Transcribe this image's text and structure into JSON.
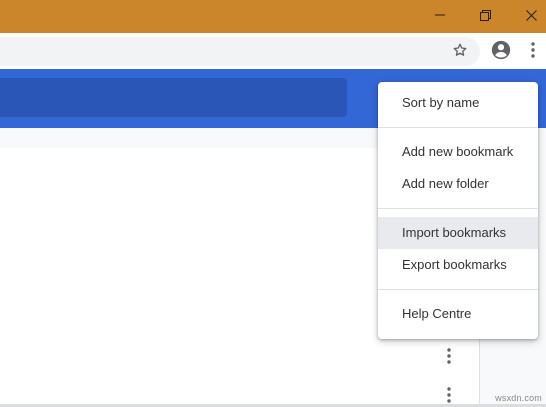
{
  "window": {
    "controls": [
      {
        "name": "minimize-icon"
      },
      {
        "name": "restore-icon"
      },
      {
        "name": "close-icon"
      }
    ],
    "titlebar_color": "#cb862b"
  },
  "toolbar": {
    "icons": [
      "star-icon",
      "account-icon",
      "more-vert-icon"
    ]
  },
  "header": {
    "band_color": "#3367d6"
  },
  "menu": {
    "items": [
      {
        "label": "Sort by name"
      },
      {
        "label": "Add new bookmark"
      },
      {
        "label": "Add new folder"
      },
      {
        "label": "Import bookmarks",
        "highlighted": true
      },
      {
        "label": "Export bookmarks"
      },
      {
        "label": "Help Centre"
      }
    ]
  },
  "watermark": "wsxdn.com"
}
